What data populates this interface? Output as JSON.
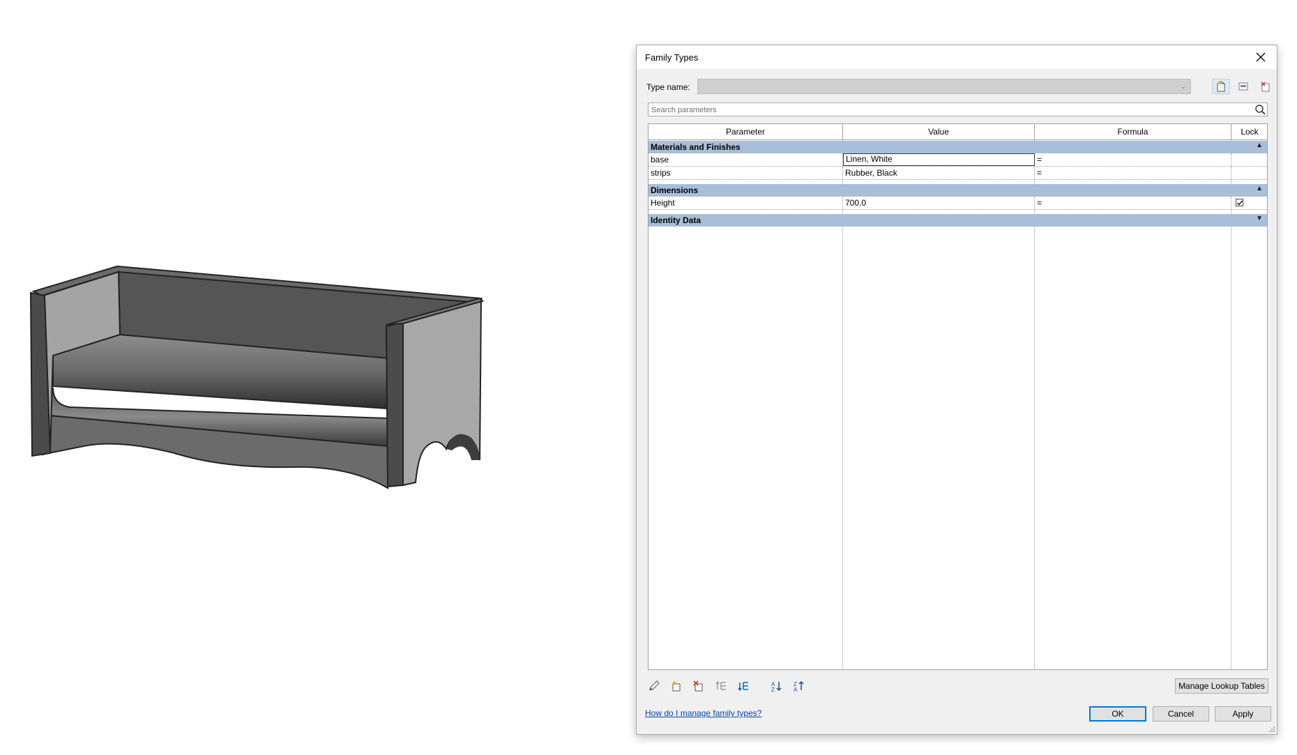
{
  "dialog": {
    "title": "Family Types",
    "type_name_label": "Type name:",
    "type_name_value": "",
    "search_placeholder": "Search parameters",
    "columns": {
      "parameter": "Parameter",
      "value": "Value",
      "formula": "Formula",
      "lock": "Lock"
    },
    "groups": [
      {
        "label": "Materials and Finishes",
        "expanded": true,
        "rows": [
          {
            "parameter": "base",
            "value": "Linen, White",
            "formula": "=",
            "locked": false,
            "editing": true
          },
          {
            "parameter": "strips",
            "value": "Rubber, Black",
            "formula": "=",
            "locked": false
          }
        ]
      },
      {
        "label": "Dimensions",
        "expanded": true,
        "rows": [
          {
            "parameter": "Height",
            "value": "700.0",
            "formula": "=",
            "locked": true
          }
        ]
      },
      {
        "label": "Identity Data",
        "expanded": false,
        "rows": []
      }
    ],
    "manage_lookup_label": "Manage Lookup Tables",
    "help_link": "How do I manage family types?",
    "ok_label": "OK",
    "cancel_label": "Cancel",
    "apply_label": "Apply"
  },
  "icons": {
    "close": "close-icon",
    "new_type": "new-type-icon",
    "rename_type": "rename-type-icon",
    "delete_type": "delete-type-icon",
    "search": "search-icon",
    "edit": "pencil-icon",
    "new_param": "new-parameter-icon",
    "delete_param": "delete-parameter-icon",
    "move_up": "move-up-icon",
    "move_down": "move-down-icon",
    "sort_asc": "sort-ascending-icon",
    "sort_desc": "sort-descending-icon"
  },
  "colors": {
    "group_header": "#a9bed8",
    "dialog_bg": "#f0f0f0",
    "link": "#0645ad",
    "accent": "#0078d7"
  }
}
